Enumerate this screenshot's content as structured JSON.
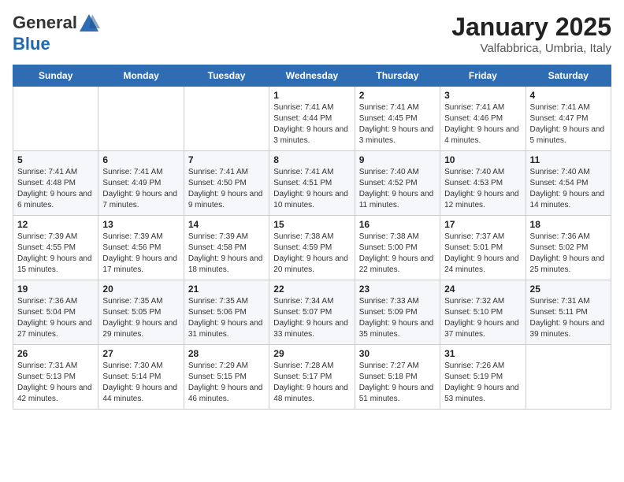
{
  "header": {
    "logo_general": "General",
    "logo_blue": "Blue",
    "month_title": "January 2025",
    "subtitle": "Valfabbrica, Umbria, Italy"
  },
  "days_of_week": [
    "Sunday",
    "Monday",
    "Tuesday",
    "Wednesday",
    "Thursday",
    "Friday",
    "Saturday"
  ],
  "weeks": [
    [
      {
        "day": "",
        "info": ""
      },
      {
        "day": "",
        "info": ""
      },
      {
        "day": "",
        "info": ""
      },
      {
        "day": "1",
        "info": "Sunrise: 7:41 AM\nSunset: 4:44 PM\nDaylight: 9 hours and 3 minutes."
      },
      {
        "day": "2",
        "info": "Sunrise: 7:41 AM\nSunset: 4:45 PM\nDaylight: 9 hours and 3 minutes."
      },
      {
        "day": "3",
        "info": "Sunrise: 7:41 AM\nSunset: 4:46 PM\nDaylight: 9 hours and 4 minutes."
      },
      {
        "day": "4",
        "info": "Sunrise: 7:41 AM\nSunset: 4:47 PM\nDaylight: 9 hours and 5 minutes."
      }
    ],
    [
      {
        "day": "5",
        "info": "Sunrise: 7:41 AM\nSunset: 4:48 PM\nDaylight: 9 hours and 6 minutes."
      },
      {
        "day": "6",
        "info": "Sunrise: 7:41 AM\nSunset: 4:49 PM\nDaylight: 9 hours and 7 minutes."
      },
      {
        "day": "7",
        "info": "Sunrise: 7:41 AM\nSunset: 4:50 PM\nDaylight: 9 hours and 9 minutes."
      },
      {
        "day": "8",
        "info": "Sunrise: 7:41 AM\nSunset: 4:51 PM\nDaylight: 9 hours and 10 minutes."
      },
      {
        "day": "9",
        "info": "Sunrise: 7:40 AM\nSunset: 4:52 PM\nDaylight: 9 hours and 11 minutes."
      },
      {
        "day": "10",
        "info": "Sunrise: 7:40 AM\nSunset: 4:53 PM\nDaylight: 9 hours and 12 minutes."
      },
      {
        "day": "11",
        "info": "Sunrise: 7:40 AM\nSunset: 4:54 PM\nDaylight: 9 hours and 14 minutes."
      }
    ],
    [
      {
        "day": "12",
        "info": "Sunrise: 7:39 AM\nSunset: 4:55 PM\nDaylight: 9 hours and 15 minutes."
      },
      {
        "day": "13",
        "info": "Sunrise: 7:39 AM\nSunset: 4:56 PM\nDaylight: 9 hours and 17 minutes."
      },
      {
        "day": "14",
        "info": "Sunrise: 7:39 AM\nSunset: 4:58 PM\nDaylight: 9 hours and 18 minutes."
      },
      {
        "day": "15",
        "info": "Sunrise: 7:38 AM\nSunset: 4:59 PM\nDaylight: 9 hours and 20 minutes."
      },
      {
        "day": "16",
        "info": "Sunrise: 7:38 AM\nSunset: 5:00 PM\nDaylight: 9 hours and 22 minutes."
      },
      {
        "day": "17",
        "info": "Sunrise: 7:37 AM\nSunset: 5:01 PM\nDaylight: 9 hours and 24 minutes."
      },
      {
        "day": "18",
        "info": "Sunrise: 7:36 AM\nSunset: 5:02 PM\nDaylight: 9 hours and 25 minutes."
      }
    ],
    [
      {
        "day": "19",
        "info": "Sunrise: 7:36 AM\nSunset: 5:04 PM\nDaylight: 9 hours and 27 minutes."
      },
      {
        "day": "20",
        "info": "Sunrise: 7:35 AM\nSunset: 5:05 PM\nDaylight: 9 hours and 29 minutes."
      },
      {
        "day": "21",
        "info": "Sunrise: 7:35 AM\nSunset: 5:06 PM\nDaylight: 9 hours and 31 minutes."
      },
      {
        "day": "22",
        "info": "Sunrise: 7:34 AM\nSunset: 5:07 PM\nDaylight: 9 hours and 33 minutes."
      },
      {
        "day": "23",
        "info": "Sunrise: 7:33 AM\nSunset: 5:09 PM\nDaylight: 9 hours and 35 minutes."
      },
      {
        "day": "24",
        "info": "Sunrise: 7:32 AM\nSunset: 5:10 PM\nDaylight: 9 hours and 37 minutes."
      },
      {
        "day": "25",
        "info": "Sunrise: 7:31 AM\nSunset: 5:11 PM\nDaylight: 9 hours and 39 minutes."
      }
    ],
    [
      {
        "day": "26",
        "info": "Sunrise: 7:31 AM\nSunset: 5:13 PM\nDaylight: 9 hours and 42 minutes."
      },
      {
        "day": "27",
        "info": "Sunrise: 7:30 AM\nSunset: 5:14 PM\nDaylight: 9 hours and 44 minutes."
      },
      {
        "day": "28",
        "info": "Sunrise: 7:29 AM\nSunset: 5:15 PM\nDaylight: 9 hours and 46 minutes."
      },
      {
        "day": "29",
        "info": "Sunrise: 7:28 AM\nSunset: 5:17 PM\nDaylight: 9 hours and 48 minutes."
      },
      {
        "day": "30",
        "info": "Sunrise: 7:27 AM\nSunset: 5:18 PM\nDaylight: 9 hours and 51 minutes."
      },
      {
        "day": "31",
        "info": "Sunrise: 7:26 AM\nSunset: 5:19 PM\nDaylight: 9 hours and 53 minutes."
      },
      {
        "day": "",
        "info": ""
      }
    ]
  ]
}
